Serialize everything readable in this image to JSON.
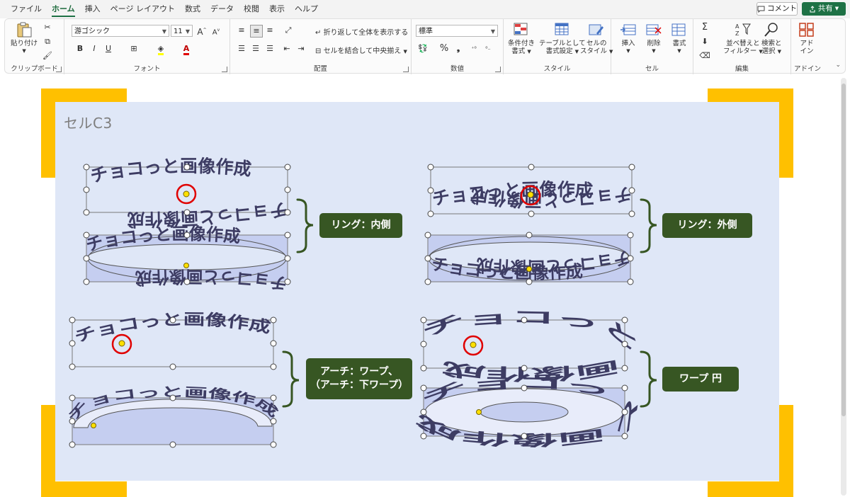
{
  "menu": {
    "tabs": [
      "ファイル",
      "ホーム",
      "挿入",
      "ページ レイアウト",
      "数式",
      "データ",
      "校閲",
      "表示",
      "ヘルプ"
    ],
    "active": "ホーム",
    "comment_label": "コメント",
    "share_label": "共有"
  },
  "ribbon": {
    "clipboard": {
      "label": "クリップボード",
      "paste": "貼り付け"
    },
    "font": {
      "label": "フォント",
      "font_name": "游ゴシック",
      "font_size": "11",
      "bold": "B",
      "italic": "I",
      "underline": "U",
      "grow": "A",
      "shrink": "A"
    },
    "alignment": {
      "label": "配置",
      "wrap_text": "折り返して全体を表示する",
      "merge_center": "セルを結合して中央揃え"
    },
    "number": {
      "label": "数値",
      "format": "標準",
      "percent": "%",
      "comma": "❟"
    },
    "styles": {
      "label": "スタイル",
      "conditional": [
        "条件付き",
        "書式"
      ],
      "table": [
        "テーブルとして",
        "書式設定"
      ],
      "cell_styles": [
        "セルの",
        "スタイル"
      ]
    },
    "cells": {
      "label": "セル",
      "insert": "挿入",
      "delete": "削除",
      "format": "書式"
    },
    "editing": {
      "label": "編集",
      "sort": [
        "並べ替えと",
        "フィルター"
      ],
      "find": [
        "検索と",
        "選択"
      ]
    },
    "addins": {
      "label": "アドイン",
      "addin": [
        "アド",
        "イン"
      ]
    }
  },
  "sheet": {
    "cell_ref": "セルC3",
    "sample_text": "チョコっと画像作成",
    "callouts": [
      "リング：内側",
      "リング：外側",
      [
        "アーチ：ワープ、",
        "（アーチ：下ワープ）"
      ],
      "ワープ 円"
    ]
  },
  "colors": {
    "accent": "#1e7145",
    "callout": "#375623",
    "panel": "#dfe7f7",
    "frame": "#ffc000",
    "warp_text": "#3d3c63",
    "fill": "#c5cef0",
    "marker": "#ff0000"
  }
}
